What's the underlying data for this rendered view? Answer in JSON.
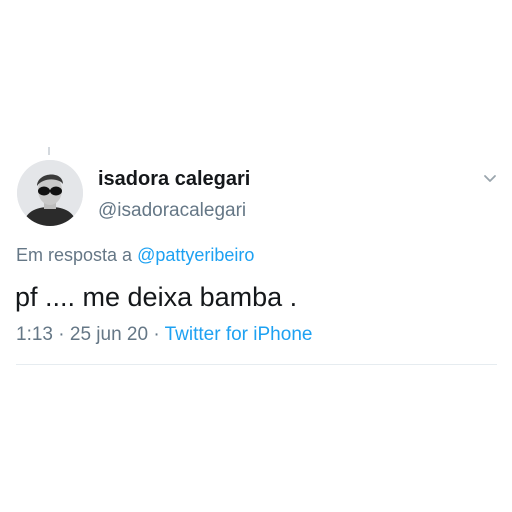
{
  "tweet": {
    "author": {
      "name": "isadora calegari",
      "handle": "@isadoracalegari",
      "avatar_icon": "user-avatar-sunglasses"
    },
    "reply": {
      "prefix": "Em resposta a ",
      "mention": "@pattyeribeiro"
    },
    "text": "pf .... me deixa bamba .",
    "meta": {
      "time": "1:13",
      "separator": " · ",
      "date": "25 jun 20",
      "source": "Twitter for iPhone"
    },
    "menu_icon": "chevron-down-icon"
  },
  "colors": {
    "text_primary": "#14171a",
    "text_secondary": "#657786",
    "link": "#1da1f2",
    "divider": "#e6ecf0"
  }
}
